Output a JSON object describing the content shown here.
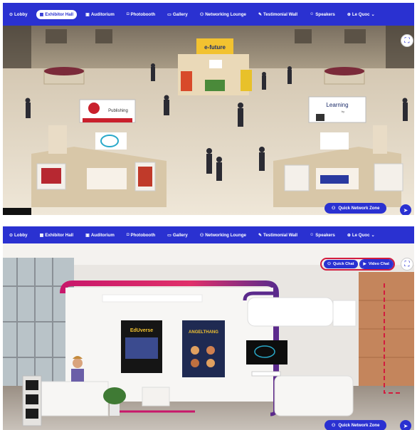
{
  "nav": {
    "items": [
      {
        "label": "Lobby",
        "icon": "target-icon"
      },
      {
        "label": "Exhibitor Hall",
        "icon": "grid-icon"
      },
      {
        "label": "Auditorium",
        "icon": "screen-icon"
      },
      {
        "label": "Photobooth",
        "icon": "camera-icon"
      },
      {
        "label": "Gallery",
        "icon": "image-icon"
      },
      {
        "label": "Networking Lounge",
        "icon": "people-icon"
      },
      {
        "label": "Testimonial Wall",
        "icon": "pencil-icon"
      },
      {
        "label": "Speakers",
        "icon": "person-icon"
      }
    ],
    "user_label": "Le Quoc",
    "active_top": "Exhibitor Hall"
  },
  "hall": {
    "booth_center_brand": "e-future",
    "booth_left_brand": "Publishing",
    "booth_right_brand": "Learning",
    "booth_right_sub": "by"
  },
  "booth": {
    "quick_chat_label": "Quick Chat",
    "video_chat_label": "Video Chat",
    "poster_left_title": "EdUverse",
    "poster_right_title": "ANGELTHANG"
  },
  "quick_network_label": "Quick Network Zone",
  "colors": {
    "nav_blue": "#2a31d1",
    "highlight_red": "#d21c3e",
    "booth_magenta": "#c8176a",
    "booth_purple": "#5b2a8c"
  }
}
